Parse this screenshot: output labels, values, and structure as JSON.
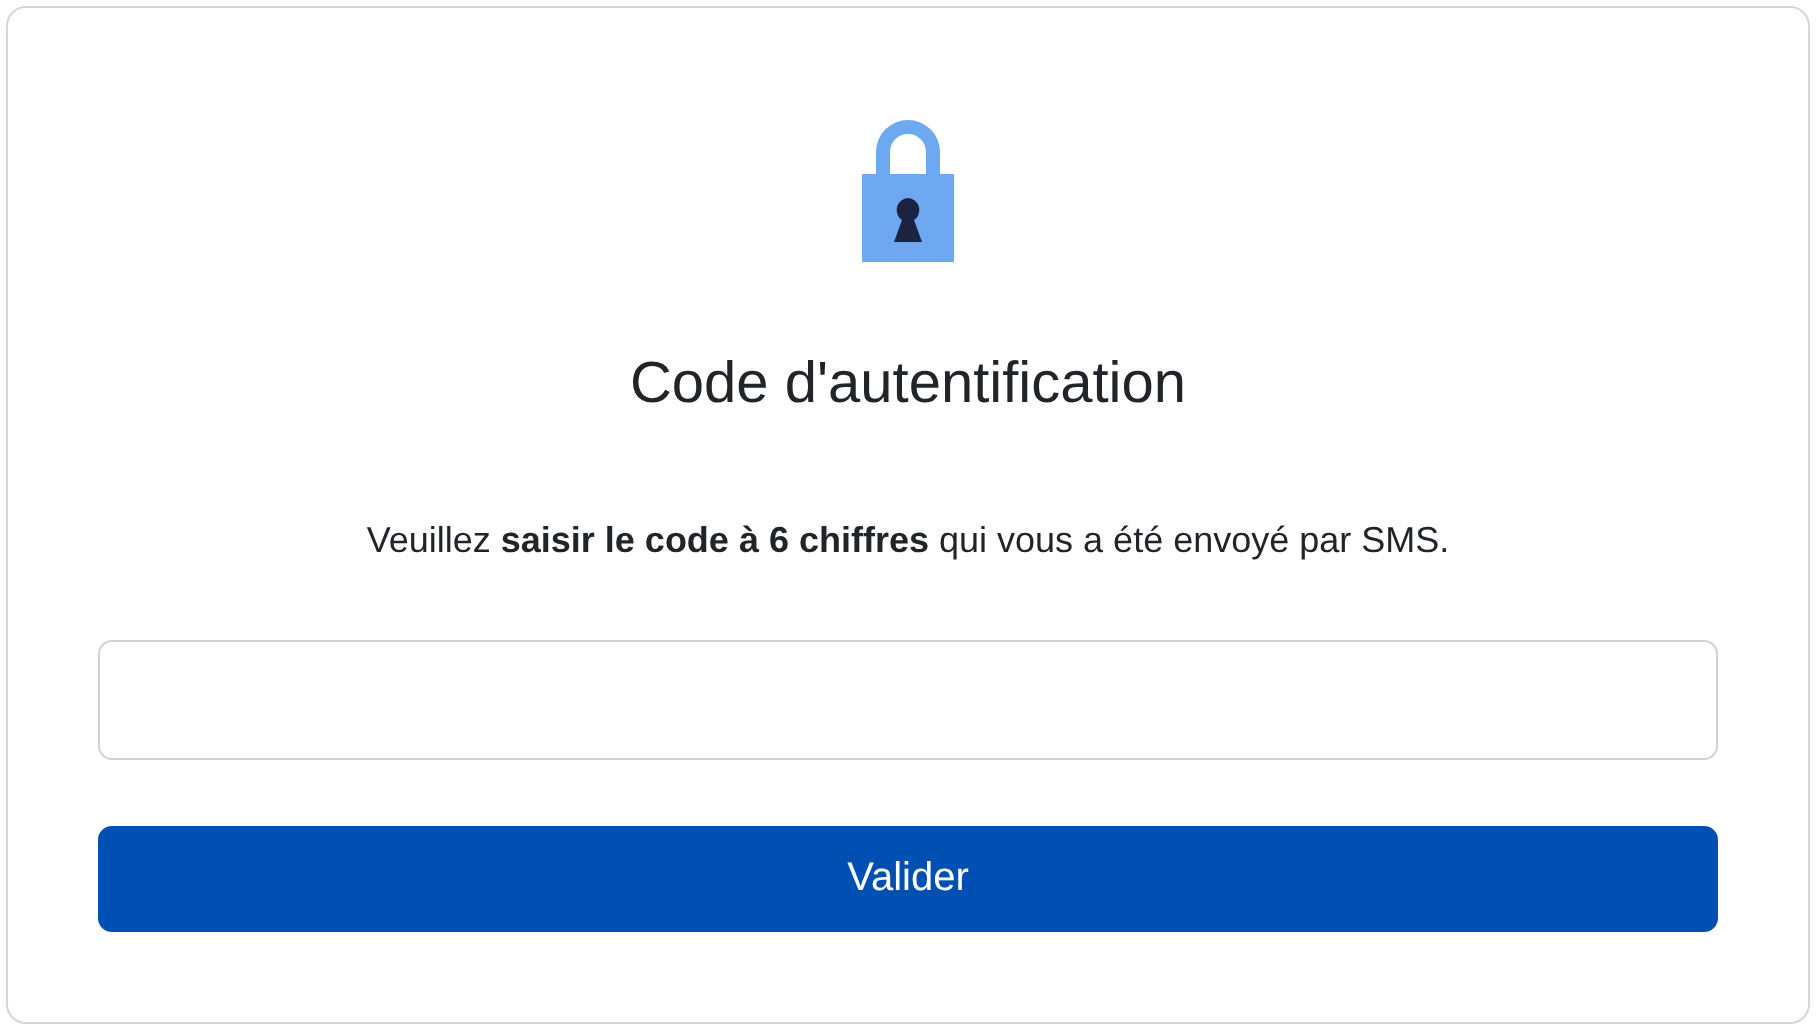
{
  "title": "Code d'autentification",
  "message": "Veuillez **saisir le code à 6 chiffres** qui vous a été envoyé par SMS.",
  "submit_button": {
    "label": "Valider"
  }
}
